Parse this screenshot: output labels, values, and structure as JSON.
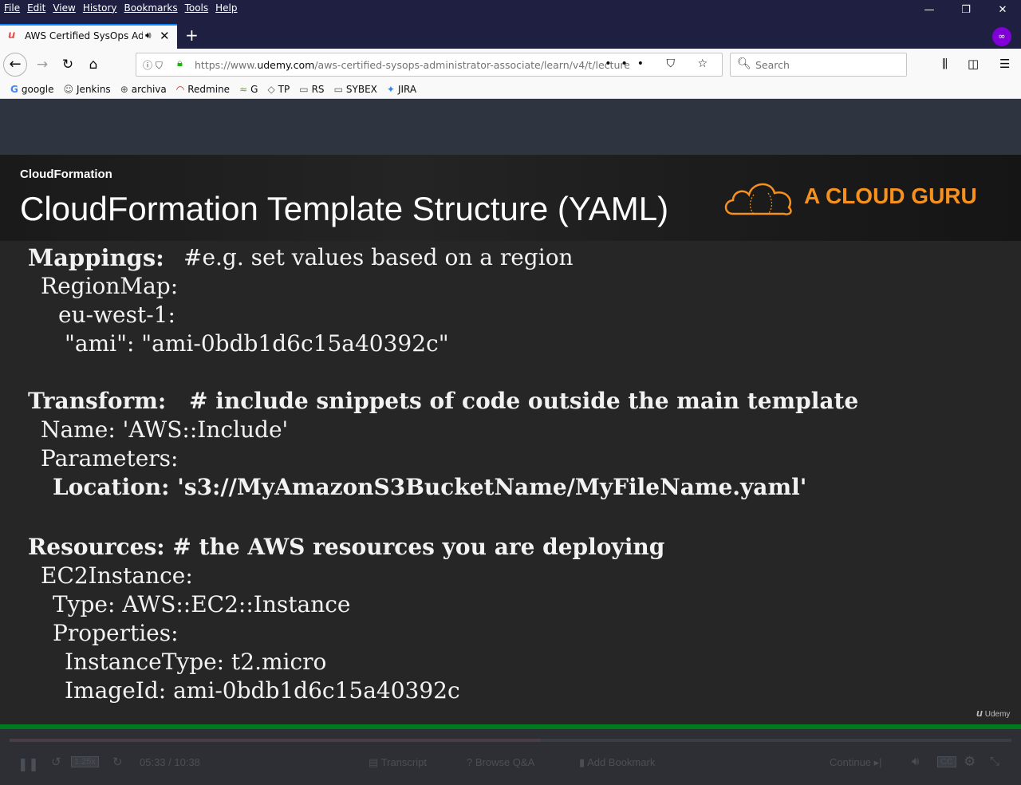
{
  "browser": {
    "menu": [
      "File",
      "Edit",
      "View",
      "History",
      "Bookmarks",
      "Tools",
      "Help"
    ],
    "window_controls": {
      "minimize": "—",
      "restore": "❐",
      "close": "✕"
    },
    "tab": {
      "title": "AWS Certified SysOps Administrator - Associate"
    },
    "new_tab": "+",
    "url": {
      "prefix": "https://www.",
      "domain": "udemy.com",
      "path": "/aws-certified-sysops-administrator-associate/learn/v4/t/lecture/"
    },
    "search_placeholder": "Search",
    "bookmarks": [
      {
        "label": "google",
        "icon": "G"
      },
      {
        "label": "Jenkins",
        "icon": "☺"
      },
      {
        "label": "archiva",
        "icon": "⊕"
      },
      {
        "label": "Redmine",
        "icon": "◠"
      },
      {
        "label": "G",
        "icon": "≈"
      },
      {
        "label": "TP",
        "icon": "◇"
      },
      {
        "label": "RS",
        "icon": "▭"
      },
      {
        "label": "SYBEX",
        "icon": "▭"
      },
      {
        "label": "JIRA",
        "icon": "✦"
      }
    ]
  },
  "slide": {
    "section": "CloudFormation",
    "heading": "CloudFormation Template Structure (YAML)",
    "brand": "A CLOUD GURU",
    "lines": [
      {
        "text": "Mappings:",
        "bold": true
      },
      {
        "text": "#e.g. set values based on a region",
        "bold": false
      },
      {
        "text": "RegionMap:",
        "bold": false
      },
      {
        "text": "eu-west-1:",
        "bold": false
      },
      {
        "text": "\"ami\": \"ami-0bdb1d6c15a40392c\"",
        "bold": false
      },
      {
        "text": "Transform:",
        "bold": true
      },
      {
        "text": "# include snippets of code outside the main template",
        "bold": true
      },
      {
        "text": "Name: 'AWS::Include'",
        "bold": false
      },
      {
        "text": "Parameters:",
        "bold": false
      },
      {
        "text": "Location: 's3://MyAmazonS3BucketName/MyFileName.yaml'",
        "bold": true
      },
      {
        "text": "Resources: # the AWS resources you are deploying",
        "bold": true
      },
      {
        "text": "EC2Instance:",
        "bold": false
      },
      {
        "text": "Type: AWS::EC2::Instance",
        "bold": false
      },
      {
        "text": "Properties:",
        "bold": false
      },
      {
        "text": "InstanceType: t2.micro",
        "bold": false
      },
      {
        "text": "ImageId: ami-0bdb1d6c15a40392c",
        "bold": false
      }
    ],
    "watermark": "Udemy"
  },
  "player": {
    "progress": 0.53,
    "speed": "1.25x",
    "time": "05:33 / 10:38",
    "transcript": "Transcript",
    "browse_qa": "Browse Q&A",
    "add_bookmark": "Add Bookmark",
    "continue": "Continue"
  },
  "colors": {
    "brand_orange": "#f7911d",
    "progress_green": "#007a1f",
    "firefox_blue": "#0a84ff"
  }
}
